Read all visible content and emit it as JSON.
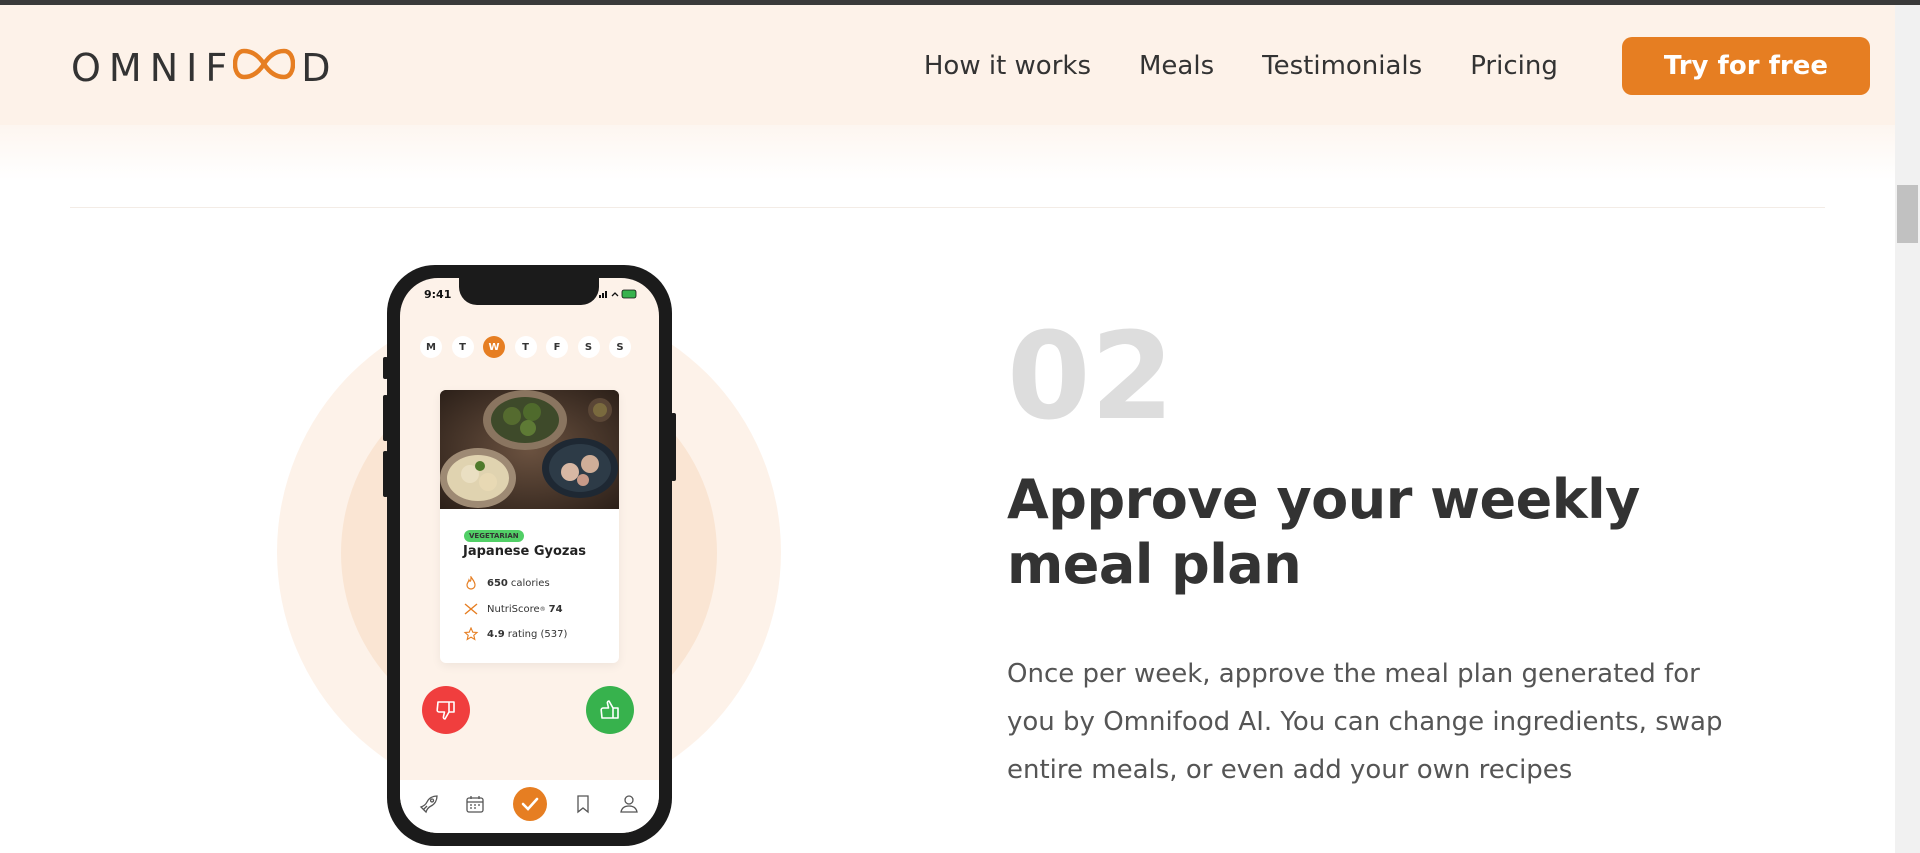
{
  "header": {
    "logo_text_left": "OMNIF",
    "logo_text_right": "D",
    "nav": [
      {
        "label": "How it works"
      },
      {
        "label": "Meals"
      },
      {
        "label": "Testimonials"
      },
      {
        "label": "Pricing"
      }
    ],
    "cta_label": "Try for free"
  },
  "phone": {
    "time": "9:41",
    "days": [
      "M",
      "T",
      "W",
      "T",
      "F",
      "S",
      "S"
    ],
    "active_day": "W",
    "card": {
      "tag": "VEGETARIAN",
      "title": "Japanese Gyozas",
      "calories_value": "650",
      "calories_label": "calories",
      "nutriscore_label": "NutriScore",
      "nutriscore_reg": "®",
      "nutriscore_value": "74",
      "rating_value": "4.9",
      "rating_label": "rating (537)"
    },
    "tab_icons": [
      "rocket-icon",
      "calendar-icon",
      "check-icon",
      "bookmark-icon",
      "user-icon"
    ]
  },
  "step": {
    "number": "02",
    "title": "Approve your weekly meal plan",
    "description": "Once per week, approve the meal plan generated for you by Omnifood AI. You can change ingredients, swap entire meals, or even add your own recipes"
  },
  "colors": {
    "accent": "#e67e22",
    "header_bg": "#fdf2e9",
    "like": "#37b24d",
    "dislike": "#f03e3e",
    "step_number": "#dddddd"
  }
}
